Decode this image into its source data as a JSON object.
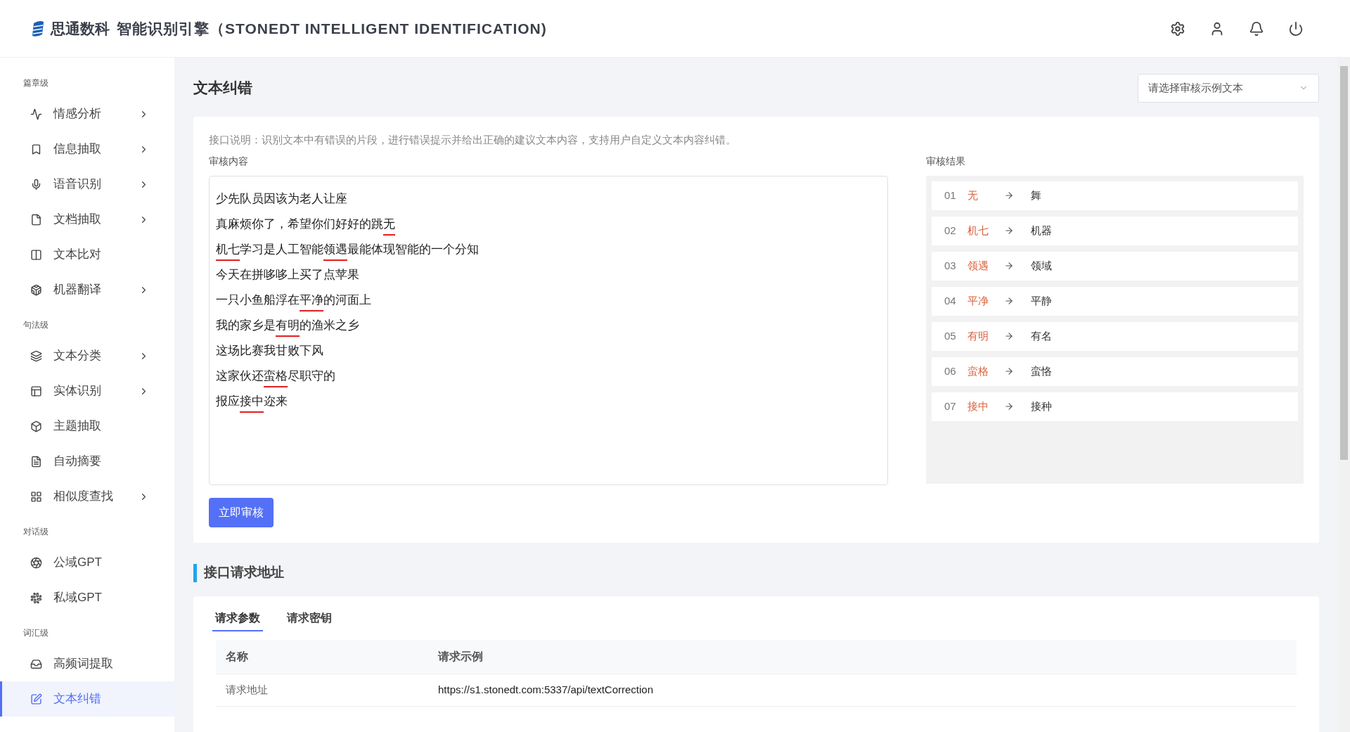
{
  "header": {
    "brand": "思通数科",
    "title": "智能识别引擎（STONEDT INTELLIGENT IDENTIFICATION)"
  },
  "sidebar": {
    "groups": [
      {
        "label": "篇章级",
        "items": [
          {
            "label": "情感分析",
            "has_submenu": true,
            "selected": false
          },
          {
            "label": "信息抽取",
            "has_submenu": true,
            "selected": false
          },
          {
            "label": "语音识别",
            "has_submenu": true,
            "selected": false
          },
          {
            "label": "文档抽取",
            "has_submenu": true,
            "selected": false
          },
          {
            "label": "文本比对",
            "has_submenu": false,
            "selected": false
          },
          {
            "label": "机器翻译",
            "has_submenu": true,
            "selected": false
          }
        ]
      },
      {
        "label": "句法级",
        "items": [
          {
            "label": "文本分类",
            "has_submenu": true,
            "selected": false
          },
          {
            "label": "实体识别",
            "has_submenu": true,
            "selected": false
          },
          {
            "label": "主题抽取",
            "has_submenu": false,
            "selected": false
          },
          {
            "label": "自动摘要",
            "has_submenu": false,
            "selected": false
          },
          {
            "label": "相似度查找",
            "has_submenu": true,
            "selected": false
          }
        ]
      },
      {
        "label": "对话级",
        "items": [
          {
            "label": "公域GPT",
            "has_submenu": false,
            "selected": false
          },
          {
            "label": "私域GPT",
            "has_submenu": false,
            "selected": false
          }
        ]
      },
      {
        "label": "词汇级",
        "items": [
          {
            "label": "高频词提取",
            "has_submenu": false,
            "selected": false
          },
          {
            "label": "文本纠错",
            "has_submenu": false,
            "selected": true
          }
        ]
      }
    ]
  },
  "page": {
    "title": "文本纠错",
    "sample_select": {
      "placeholder": "请选择审核示例文本"
    },
    "description": "接口说明：识别文本中有错误的片段，进行错误提示并给出正确的建议文本内容，支持用户自定义文本内容纠错。",
    "input_label": "审核内容",
    "input_lines": [
      [
        {
          "text": "少先队员因该为老人让座",
          "error": false
        }
      ],
      [
        {
          "text": "真麻烦你了，希望你们好好的跳",
          "error": false
        },
        {
          "text": "无",
          "error": true
        }
      ],
      [
        {
          "text": "机七",
          "error": true
        },
        {
          "text": "学习是人工智能",
          "error": false
        },
        {
          "text": "领遇",
          "error": true
        },
        {
          "text": "最能体现智能的一个分知",
          "error": false
        }
      ],
      [
        {
          "text": "今天在拼哆哆上买了点苹果",
          "error": false
        }
      ],
      [
        {
          "text": "一只小鱼船浮在",
          "error": false
        },
        {
          "text": "平净",
          "error": true
        },
        {
          "text": "的河面上",
          "error": false
        }
      ],
      [
        {
          "text": "我的家乡是",
          "error": false
        },
        {
          "text": "有明",
          "error": true
        },
        {
          "text": "的渔米之乡",
          "error": false
        }
      ],
      [
        {
          "text": "这场比赛我甘败下风",
          "error": false
        }
      ],
      [
        {
          "text": "这家伙还",
          "error": false
        },
        {
          "text": "蛮格",
          "error": true
        },
        {
          "text": "尽职守的",
          "error": false
        }
      ],
      [
        {
          "text": "报应",
          "error": false
        },
        {
          "text": "接中",
          "error": true
        },
        {
          "text": "迩来",
          "error": false
        }
      ]
    ],
    "result_label": "审核结果",
    "results": [
      {
        "index": "01",
        "wrong": "无",
        "correct": "舞"
      },
      {
        "index": "02",
        "wrong": "机七",
        "correct": "机器"
      },
      {
        "index": "03",
        "wrong": "领遇",
        "correct": "领域"
      },
      {
        "index": "04",
        "wrong": "平净",
        "correct": "平静"
      },
      {
        "index": "05",
        "wrong": "有明",
        "correct": "有名"
      },
      {
        "index": "06",
        "wrong": "蛮格",
        "correct": "蛮恪"
      },
      {
        "index": "07",
        "wrong": "接中",
        "correct": "接种"
      }
    ],
    "submit_button": "立即审核"
  },
  "api_section": {
    "title": "接口请求地址",
    "tabs": [
      {
        "label": "请求参数",
        "selected": true
      },
      {
        "label": "请求密钥",
        "selected": false
      }
    ],
    "table": {
      "columns": [
        "名称",
        "请求示例"
      ],
      "rows": [
        [
          "请求地址",
          "https://s1.stonedt.com:5337/api/textCorrection"
        ]
      ]
    }
  }
}
